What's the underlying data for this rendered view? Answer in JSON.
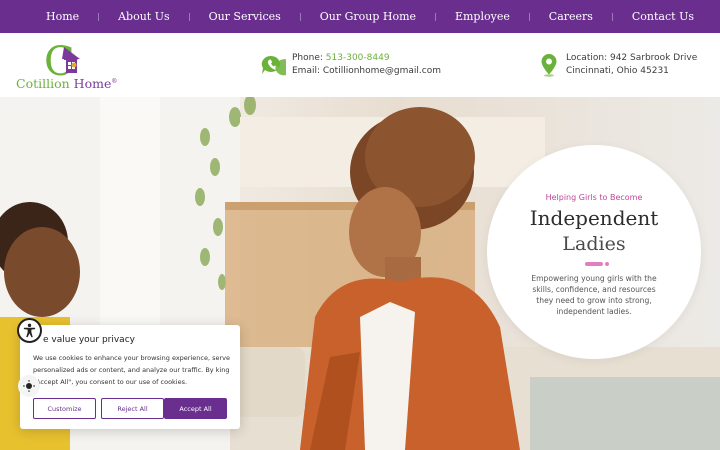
{
  "nav": {
    "items": [
      {
        "label": "Home"
      },
      {
        "label": "About Us"
      },
      {
        "label": "Our Services"
      },
      {
        "label": "Our Group Home"
      },
      {
        "label": "Employee"
      },
      {
        "label": "Careers"
      },
      {
        "label": "Contact Us"
      }
    ]
  },
  "header": {
    "logo": {
      "text_cotillion": "Cotillion",
      "text_home": "Home",
      "registered": "®",
      "mark_letter": "C"
    },
    "contact": {
      "phone_label": "Phone:",
      "phone_value": "513-300-8449",
      "email_label": "Email:",
      "email_value": "Cotillionhome@gmail.com",
      "icon": "phone-chat-icon"
    },
    "location": {
      "label": "Location:",
      "line1_value": "942 Sarbrook Drive",
      "line2": "Cincinnati, Ohio 45231",
      "icon": "map-pin-icon"
    }
  },
  "hero": {
    "kicker": "Helping Girls to Become",
    "title_line1": "Independent",
    "title_line2": "Ladies",
    "description": "Empowering young girls with the skills, confidence, and resources they need to grow into strong, independent ladies."
  },
  "cookie": {
    "title": "e value your privacy",
    "text": "We use cookies to enhance your browsing experience, serve personalized ads or content, and analyze our traffic. By king \"Accept All\", you consent to our use of cookies.",
    "customize": "Customize",
    "reject": "Reject All",
    "accept": "Accept All"
  },
  "colors": {
    "brand_purple": "#6a2e8f",
    "brand_green": "#6bb23a",
    "accent_pink": "#c2459a"
  }
}
